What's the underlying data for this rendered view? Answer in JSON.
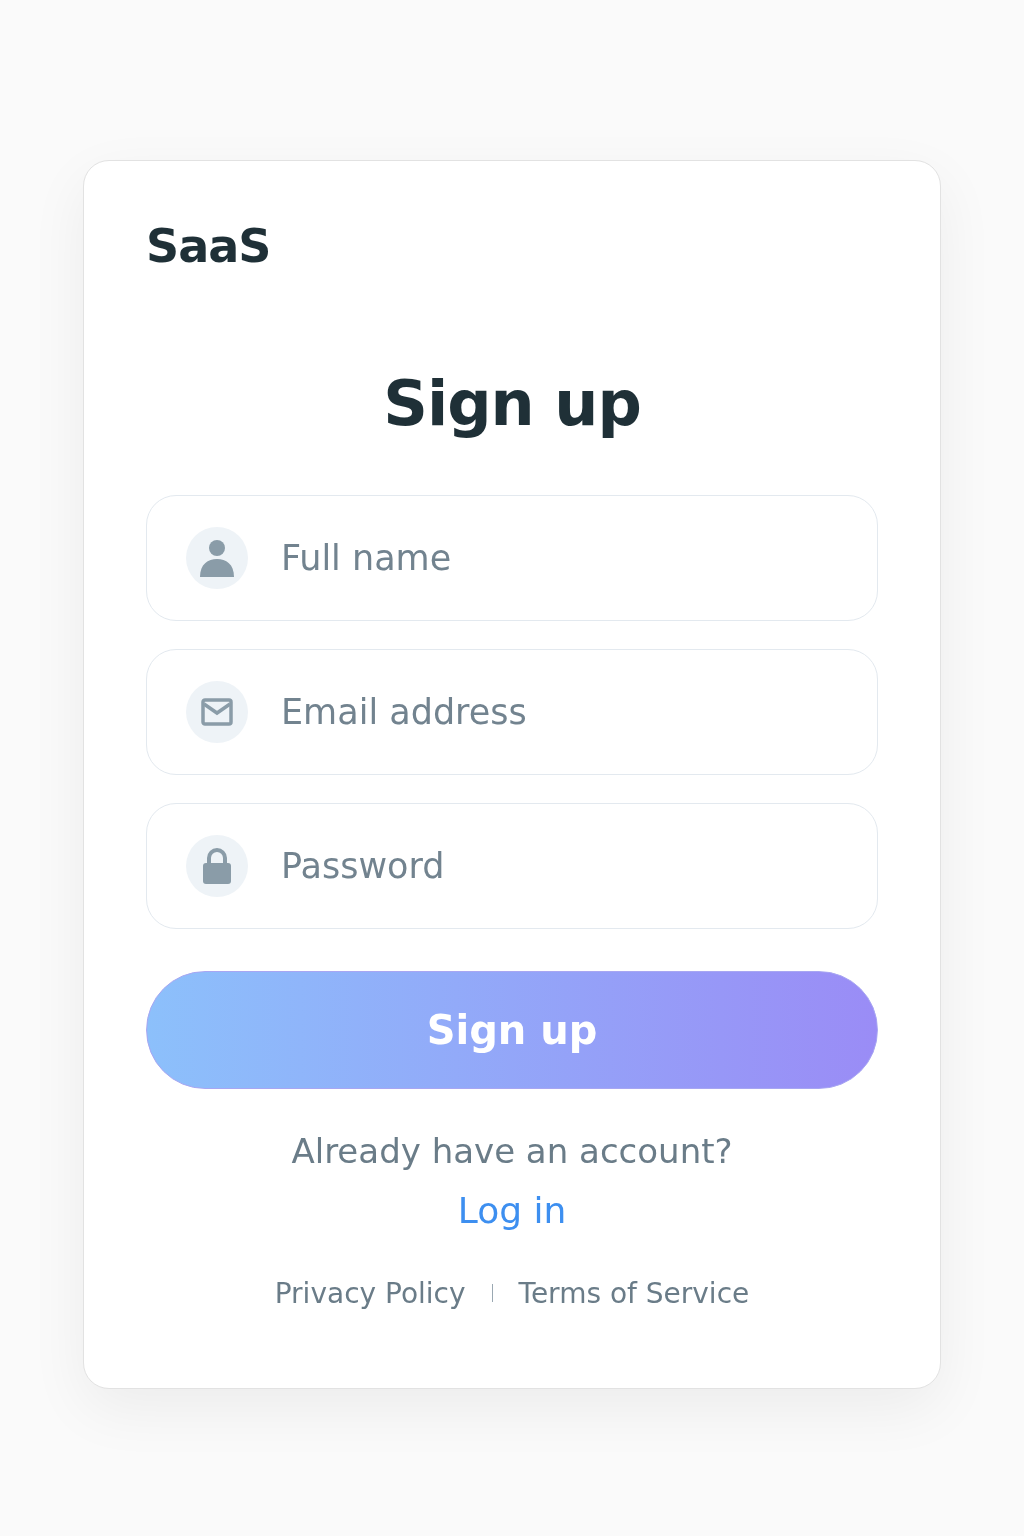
{
  "logo": "SaaS",
  "title": "Sign up",
  "fields": [
    {
      "kind": "person",
      "placeholder": "Full name"
    },
    {
      "kind": "email",
      "placeholder": "Email address"
    },
    {
      "kind": "lock",
      "placeholder": "Password"
    }
  ],
  "submit": "Sign up",
  "prompt": "Already have an account?",
  "login_link": "Log in",
  "footer_links": [
    "Privacy Policy",
    "Terms of Service"
  ]
}
